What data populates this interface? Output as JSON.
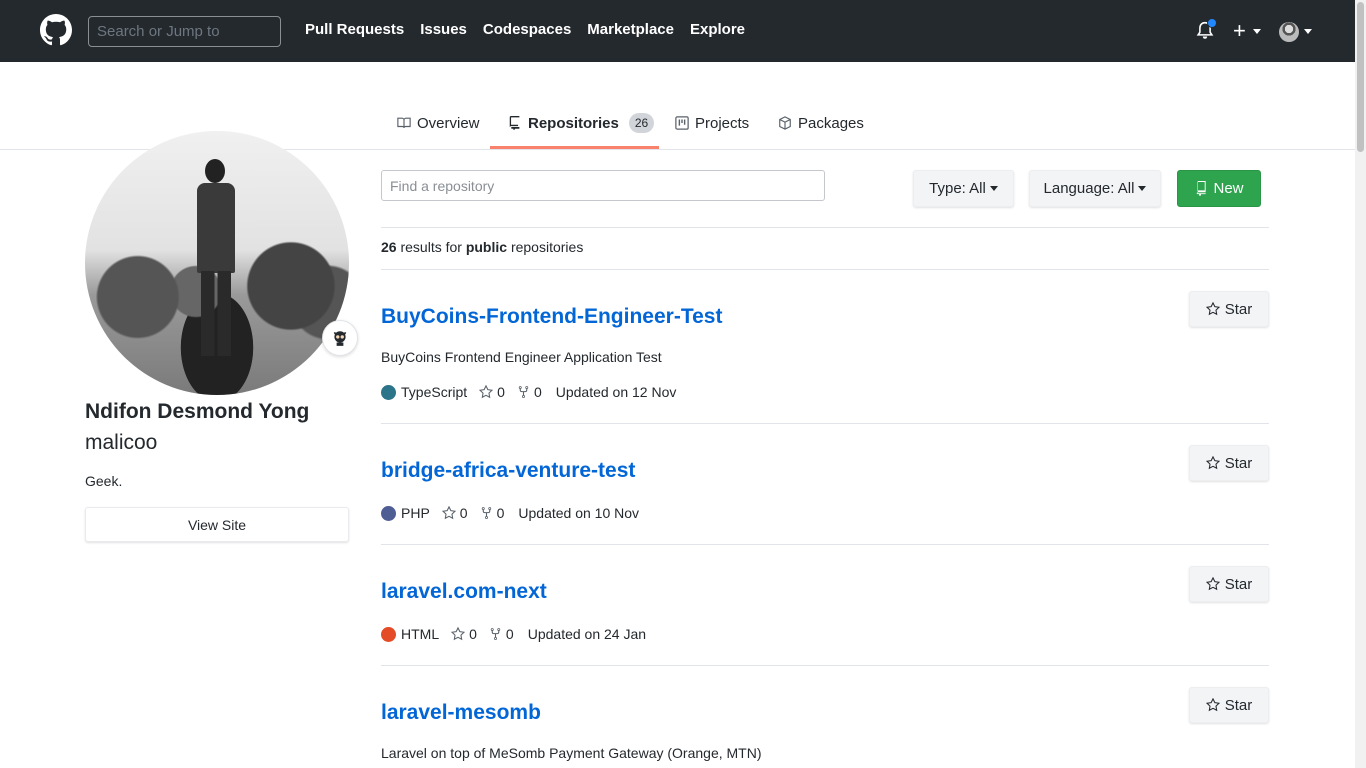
{
  "header": {
    "search_placeholder": "Search or Jump to",
    "nav": [
      "Pull Requests",
      "Issues",
      "Codespaces",
      "Marketplace",
      "Explore"
    ],
    "plus_label": "+"
  },
  "tabs": [
    {
      "label": "Overview",
      "icon": "book-icon"
    },
    {
      "label": "Repositories",
      "icon": "repo-icon",
      "count": "26"
    },
    {
      "label": "Projects",
      "icon": "project-icon"
    },
    {
      "label": "Packages",
      "icon": "package-icon"
    }
  ],
  "profile": {
    "name": "Ndifon Desmond Yong",
    "login": "malicoo",
    "bio": "Geek.",
    "view_site_label": "View Site"
  },
  "repos_toolbar": {
    "find_placeholder": "Find a repository",
    "type_label": "Type: All",
    "language_label": "Language: All",
    "new_label": "New"
  },
  "results": {
    "count": "26",
    "text_a": " results for ",
    "visibility": "public",
    "text_b": " repositories"
  },
  "repos": [
    {
      "name": "BuyCoins-Frontend-Engineer-Test",
      "description": "BuyCoins Frontend Engineer Application Test",
      "language": "TypeScript",
      "lang_color": "#2b7489",
      "stars": "0",
      "forks": "0",
      "updated": "Updated on 12 Nov",
      "star_label": "Star"
    },
    {
      "name": "bridge-africa-venture-test",
      "description": "",
      "language": "PHP",
      "lang_color": "#4F5D95",
      "stars": "0",
      "forks": "0",
      "updated": "Updated on 10 Nov",
      "star_label": "Star"
    },
    {
      "name": "laravel.com-next",
      "description": "",
      "language": "HTML",
      "lang_color": "#e34c26",
      "stars": "0",
      "forks": "0",
      "updated": "Updated on 24 Jan",
      "star_label": "Star"
    },
    {
      "name": "laravel-mesomb",
      "description": "Laravel on top of MeSomb Payment Gateway (Orange, MTN)",
      "language": "",
      "lang_color": "",
      "stars": "",
      "forks": "",
      "updated": "",
      "star_label": "Star"
    }
  ],
  "colors": {
    "header_bg": "#24292e",
    "link": "#0366d6",
    "new_button": "#2ea44f",
    "tab_underline": "#f9826c",
    "notification_dot": "#2188ff"
  }
}
